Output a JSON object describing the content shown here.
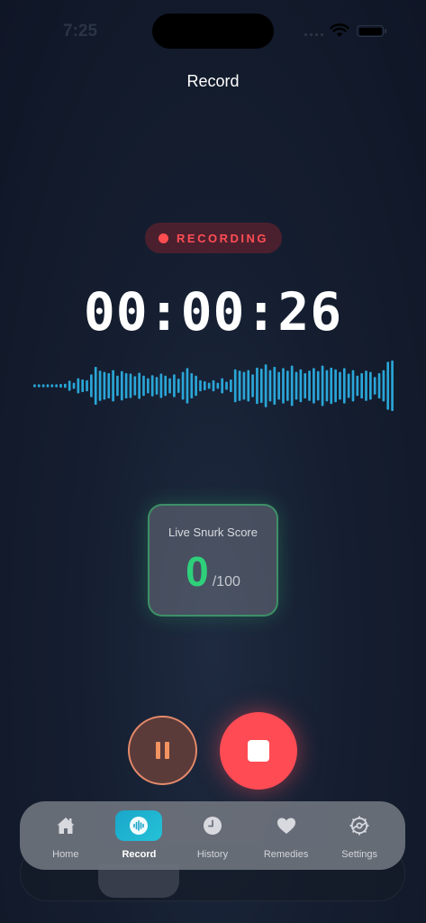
{
  "status_bar": {
    "time": "7:25"
  },
  "header": {
    "title": "Record"
  },
  "recording_badge": {
    "label": "RECORDING",
    "color": "#ff4d55"
  },
  "timer": {
    "value": "00:00:26"
  },
  "waveform": {
    "color": "#2aa6d8",
    "amplitudes": [
      0.06,
      0.06,
      0.06,
      0.06,
      0.06,
      0.06,
      0.07,
      0.08,
      0.2,
      0.12,
      0.3,
      0.25,
      0.22,
      0.45,
      0.75,
      0.6,
      0.55,
      0.5,
      0.62,
      0.4,
      0.58,
      0.5,
      0.48,
      0.38,
      0.52,
      0.4,
      0.3,
      0.42,
      0.35,
      0.48,
      0.4,
      0.3,
      0.45,
      0.28,
      0.55,
      0.7,
      0.5,
      0.4,
      0.22,
      0.18,
      0.12,
      0.22,
      0.12,
      0.3,
      0.16,
      0.25,
      0.65,
      0.6,
      0.55,
      0.62,
      0.45,
      0.72,
      0.68,
      0.85,
      0.62,
      0.75,
      0.55,
      0.7,
      0.6,
      0.8,
      0.55,
      0.65,
      0.5,
      0.6,
      0.7,
      0.58,
      0.8,
      0.62,
      0.72,
      0.65,
      0.55,
      0.7,
      0.48,
      0.62,
      0.4,
      0.5,
      0.6,
      0.55,
      0.35,
      0.5,
      0.62,
      0.95,
      1.0
    ]
  },
  "score_card": {
    "label": "Live Snurk Score",
    "value": "0",
    "max": "/100",
    "accent": "#2ed07a"
  },
  "controls": {
    "pause_color": "#f29361",
    "stop_color": "#ff4b54"
  },
  "tab_bar": {
    "accent": "#1aa6c9",
    "tabs": [
      {
        "label": "Home",
        "icon": "house-icon",
        "active": false
      },
      {
        "label": "Record",
        "icon": "waveform-icon",
        "active": true
      },
      {
        "label": "History",
        "icon": "clock-icon",
        "active": false
      },
      {
        "label": "Remedies",
        "icon": "heart-icon",
        "active": false
      },
      {
        "label": "Settings",
        "icon": "gear-icon",
        "active": false
      }
    ]
  }
}
